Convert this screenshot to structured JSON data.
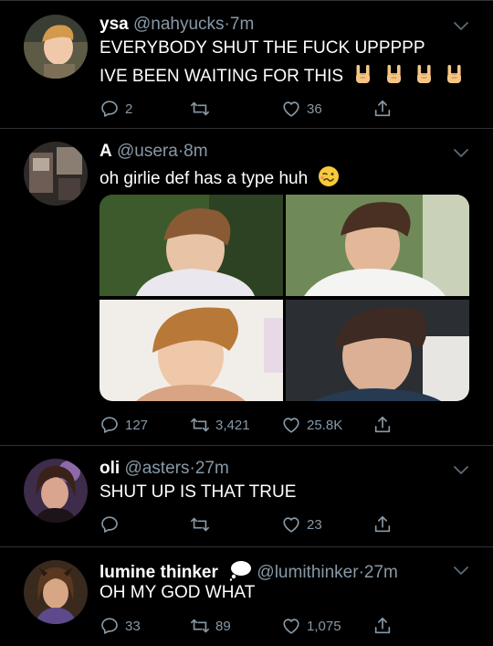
{
  "colors": {
    "background": "#000000",
    "muted": "#8899a6",
    "separator": "#2f3336"
  },
  "tweets": [
    {
      "name": "ysa",
      "handle": "@nahyucks",
      "dot": "·",
      "time": "7m",
      "lines": [
        "EVERYBODY SHUT THE FUCK UPPPPP",
        "IVE BEEN WAITING FOR THIS"
      ],
      "emoji": [
        "rock-hand-emoji",
        "rock-hand-emoji",
        "rock-hand-emoji",
        "rock-hand-emoji"
      ],
      "replies": "2",
      "retweets": "",
      "likes": "36"
    },
    {
      "name": "A",
      "handle": "@usera",
      "dot": "·",
      "time": "8m",
      "lines": [
        "oh girlie def has a type huh"
      ],
      "emoji": [
        "woozy-face-emoji"
      ],
      "media": [
        "photo-top-left",
        "photo-top-right",
        "photo-bottom-left",
        "photo-bottom-right"
      ],
      "replies": "127",
      "retweets": "3,421",
      "likes": "25.8K"
    },
    {
      "name": "oli",
      "handle": "@asters",
      "dot": "·",
      "time": "27m",
      "lines": [
        "SHUT UP IS THAT TRUE"
      ],
      "replies": "",
      "retweets": "",
      "likes": "23"
    },
    {
      "name": "lumine thinker",
      "name_emoji": "thought-balloon-emoji",
      "handle": "@lumithinker",
      "dot": "·",
      "time": "27m",
      "lines": [
        "OH MY GOD WHAT"
      ],
      "replies": "33",
      "retweets": "89",
      "likes": "1,075"
    }
  ]
}
